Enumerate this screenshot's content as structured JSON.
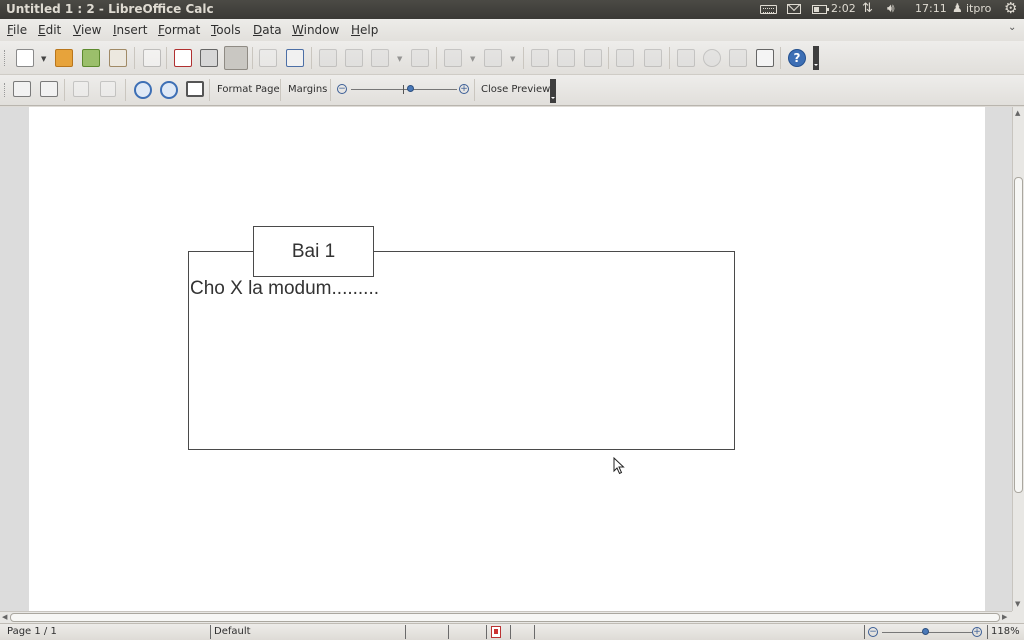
{
  "window": {
    "title": "Untitled 1 : 2 - LibreOffice Calc"
  },
  "indicators": {
    "keyboard_icon": "keyboard-icon",
    "mail_icon": "mail-icon",
    "battery_time": "2:02",
    "clock": "17:11",
    "user": "itpro"
  },
  "menu": {
    "items": [
      {
        "label": "File"
      },
      {
        "label": "Edit"
      },
      {
        "label": "View"
      },
      {
        "label": "Insert"
      },
      {
        "label": "Format"
      },
      {
        "label": "Tools"
      },
      {
        "label": "Data"
      },
      {
        "label": "Window"
      },
      {
        "label": "Help"
      }
    ]
  },
  "preview_toolbar": {
    "format_page": "Format Page",
    "margins": "Margins",
    "close_preview": "Close Preview"
  },
  "document": {
    "title_box": "Bai 1",
    "body_text": "Cho X la modum........."
  },
  "status": {
    "page": "Page 1 / 1",
    "style": "Default",
    "zoom": "118%"
  },
  "colors": {
    "top_bar": "#3c3b37",
    "toolbar": "#e8e6e2",
    "page": "#ffffff",
    "accent": "#4a79b8"
  }
}
